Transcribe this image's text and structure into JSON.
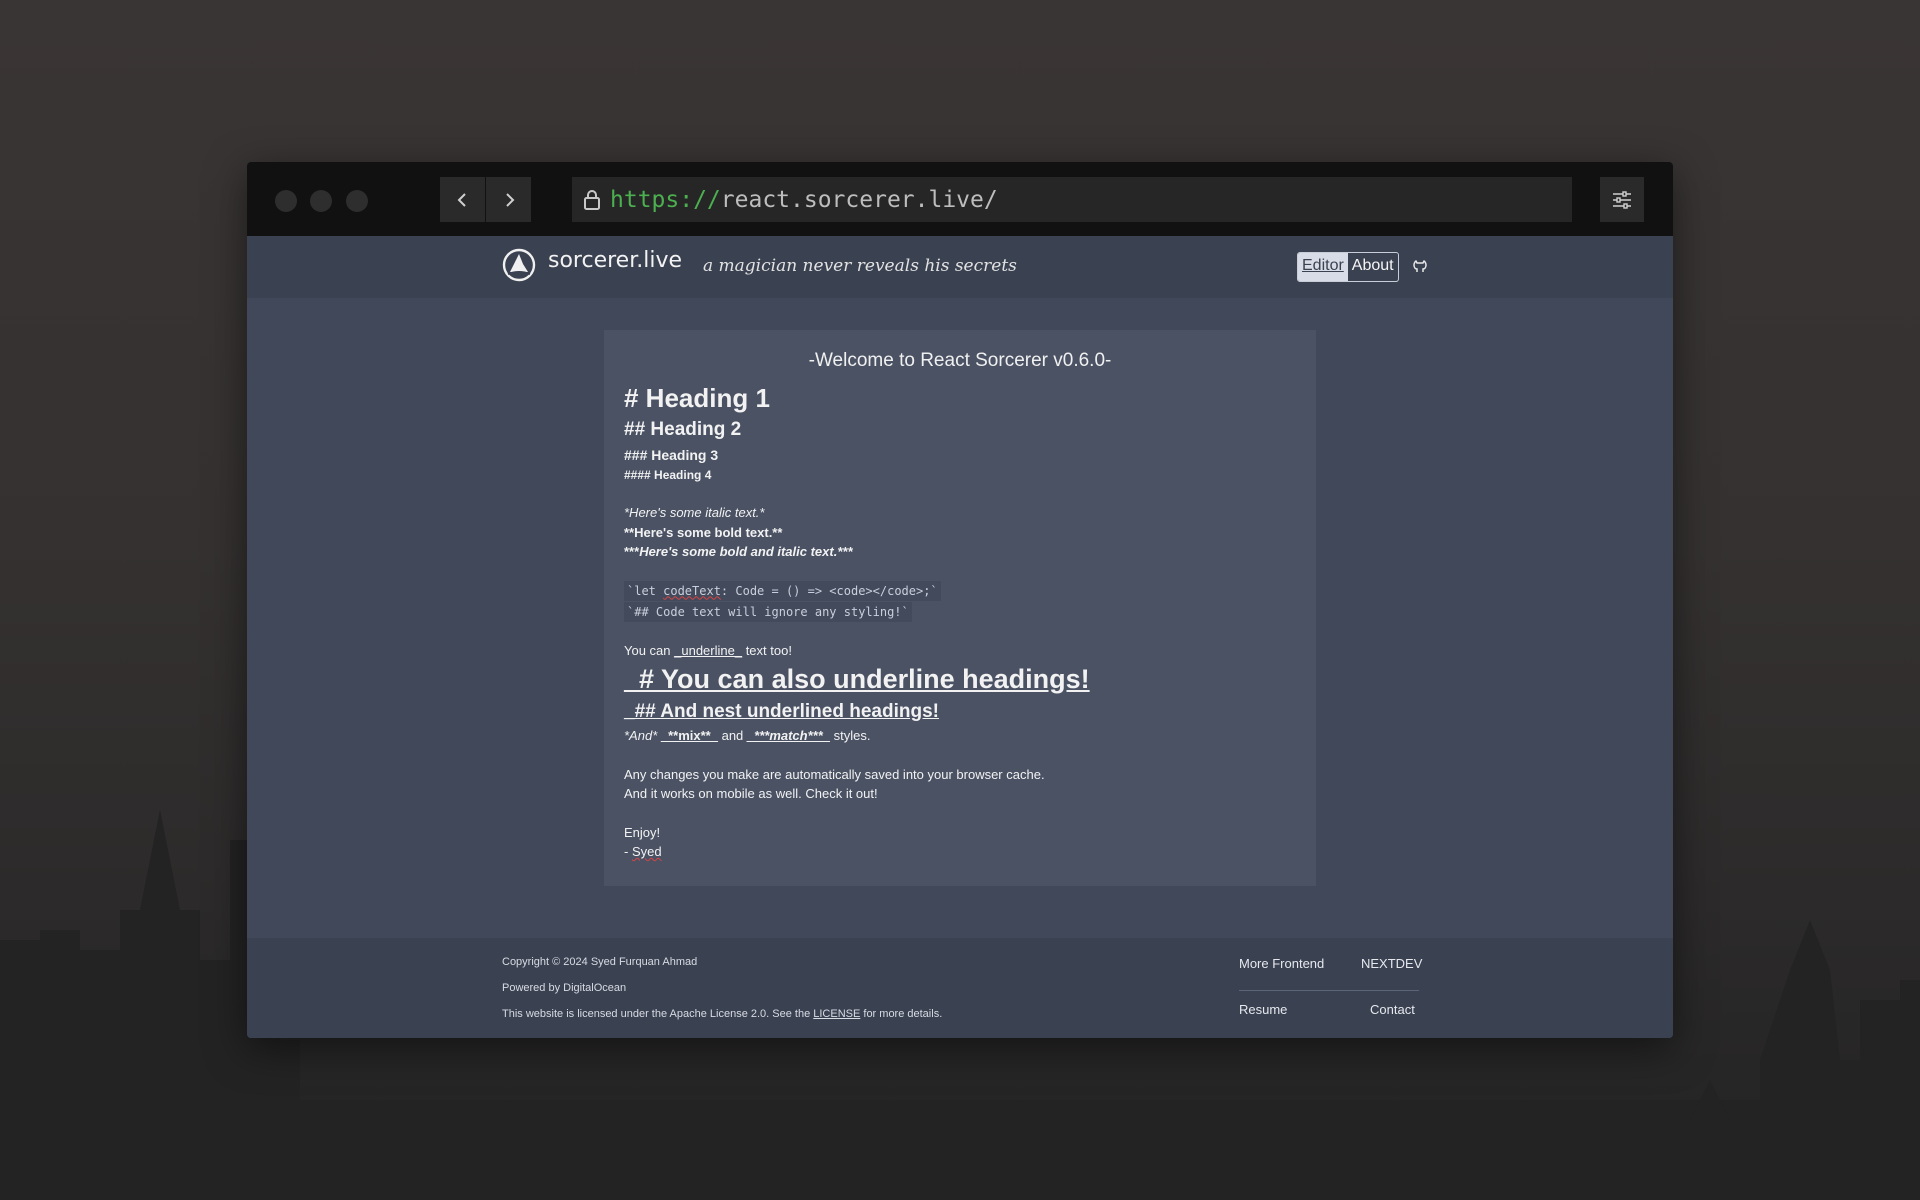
{
  "browser": {
    "url_scheme": "https://",
    "url_rest": "react.sorcerer.live/"
  },
  "header": {
    "brand": "sorcerer.live",
    "tagline": "a magician never reveals his secrets",
    "nav": [
      {
        "label": "Editor",
        "active": true
      },
      {
        "label": "About",
        "active": false
      }
    ]
  },
  "editor": {
    "welcome": "-Welcome to React Sorcerer v0.6.0-",
    "h1": "# Heading 1",
    "h2": "## Heading 2",
    "h3": "### Heading 3",
    "h4": "#### Heading 4",
    "italic": "*Here's some italic text.*",
    "bold": "**Here's some bold text.**",
    "bold_italic_prefix": "***",
    "bold_italic_rest": "Here's some bold and italic text.***",
    "code1_a": "`let ",
    "code1_b": "codeText",
    "code1_c": ": Code = () => <code></code>;`",
    "code2": "`## Code text will ignore any styling!`",
    "underline_pre": "You can ",
    "underline_word": "_underline_",
    "underline_post": " text too!",
    "uh1": "_# You can also underline headings!",
    "uh2": "_## And nest underlined headings!",
    "mix_and": "*And* ",
    "mix_word": "_**mix**_",
    "mix_mid": " and ",
    "match_word": "_***match***_",
    "mix_post": " styles.",
    "changes1": "Any changes you make are automatically saved into your browser cache.",
    "changes2": "And it works on mobile as well. Check it out!",
    "enjoy": "Enjoy!",
    "sign_prefix": "- ",
    "sign_name": "Syed"
  },
  "footer": {
    "copyright": "Copyright © 2024 Syed Furquan Ahmad",
    "powered": "Powered by DigitalOcean",
    "license_pre": "This website is licensed under the Apache License 2.0. See the ",
    "license_link": "LICENSE",
    "license_post": " for more details.",
    "links": {
      "more_frontend": "More Frontend",
      "nextdev": "NEXTDEV",
      "resume": "Resume",
      "contact": "Contact"
    }
  },
  "colors": {
    "url_scheme": "#4caf50",
    "editor_bg": "#4a5264",
    "page_bg": "#404859",
    "spellcheck": "#d64545"
  }
}
